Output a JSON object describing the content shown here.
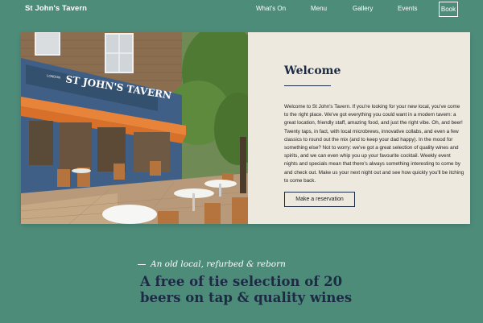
{
  "header": {
    "brand": "St John's Tavern",
    "nav": [
      {
        "label": "What's On"
      },
      {
        "label": "Menu"
      },
      {
        "label": "Gallery"
      },
      {
        "label": "Events"
      }
    ],
    "book_label": "Book"
  },
  "hero": {
    "photo": {
      "sign_text": "ST JOHN'S TAVERN",
      "sign_small": "LONDON"
    },
    "welcome": {
      "title": "Welcome",
      "body": "Welcome to St John's Tavern. If you're looking for your new local, you've come to the right place. We've got everything you could want in a modern tavern: a great location, friendly staff, amazing food, and just the right vibe. Oh, and beer! Twenty taps, in fact, with local microbrews, innovative collabs, and even a few classics to round out the mix (and to keep your dad happy). In the mood for something else? Not to worry: we've got a great selection of quality wines and spirits, and we can even whip you up your favourite cocktail. Weekly event nights and specials mean that there's always something interesting to come by and check out. Make us your next night out and see how quickly you'll be itching to come back.",
      "button_label": "Make a reservation"
    }
  },
  "intro": {
    "tagline": "An old local, refurbed & reborn",
    "headline": "A free of tie selection of 20 beers on tap & quality wines"
  },
  "colors": {
    "background": "#4e8c7a",
    "panel": "#ede9df",
    "navy": "#1c2b44",
    "awning": "#e8843a",
    "facade": "#3f5f86"
  }
}
